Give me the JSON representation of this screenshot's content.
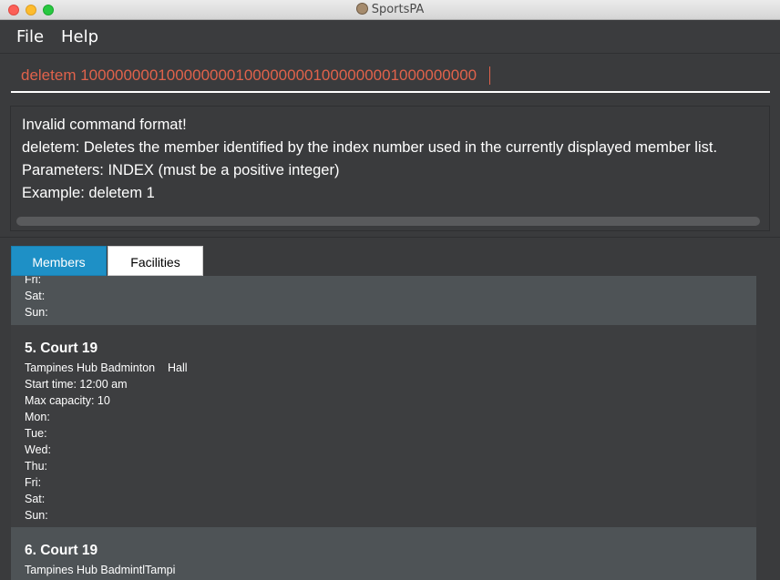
{
  "window": {
    "title": "SportsPA"
  },
  "menu": {
    "file": "File",
    "help": "Help"
  },
  "command": {
    "value": "deletem 1000000001000000001000000001000000001000000000"
  },
  "result": {
    "lines": [
      "Invalid command format!",
      "deletem: Deletes the member identified by the index number used in the currently displayed member list.",
      "Parameters: INDEX (must be a positive integer)",
      "Example: deletem 1"
    ]
  },
  "tabs": {
    "members": "Members",
    "facilities": "Facilities"
  },
  "facilities": {
    "partial_top": {
      "lines": [
        "Fri:",
        "Sat:",
        "Sun:"
      ]
    },
    "card5": {
      "title": "5. Court 19",
      "location": "Tampines Hub Badminton    Hall",
      "start_time": "Start time: 12:00 am",
      "max_capacity": "Max capacity: 10",
      "days": [
        "Mon:",
        "Tue:",
        "Wed:",
        "Thu:",
        "Fri:",
        "Sat:",
        "Sun:"
      ]
    },
    "card6": {
      "title": "6. Court 19",
      "location": "Tampines Hub BadmintlTampi"
    }
  }
}
